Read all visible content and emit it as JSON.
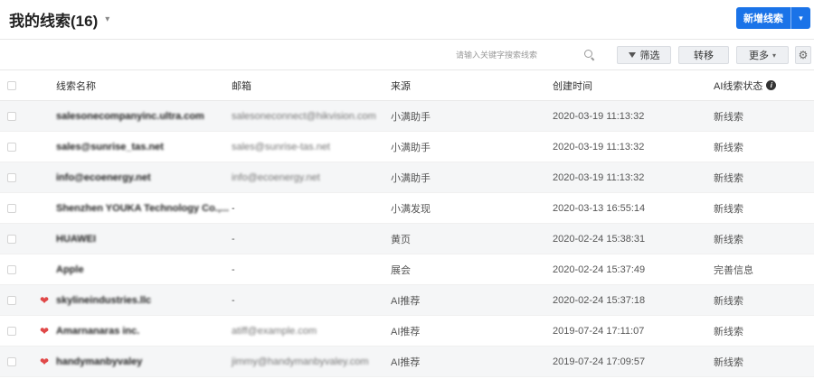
{
  "header": {
    "title": "我的线索(16)",
    "title_caret": "▾",
    "new_button_label": "新增线索",
    "new_button_caret": "▾"
  },
  "toolbar": {
    "search_placeholder": "请输入关键字搜索线索",
    "filter_label": "筛选",
    "move_label": "转移",
    "more_label": "更多",
    "more_caret": "▾",
    "gear_glyph": "⚙"
  },
  "table": {
    "columns": {
      "name": "线索名称",
      "email": "邮箱",
      "source": "来源",
      "created": "创建时间",
      "status": "AI线索状态",
      "status_info": "i"
    },
    "rows": [
      {
        "starred": false,
        "name": "salesonecompanyinc.ultra.com",
        "email": "salesoneconnect@hikvision.com",
        "source": "小满助手",
        "created": "2020-03-19 11:13:32",
        "status": "新线索"
      },
      {
        "starred": false,
        "name": "sales@sunrise_tas.net",
        "email": "sales@sunrise-tas.net",
        "source": "小满助手",
        "created": "2020-03-19 11:13:32",
        "status": "新线索"
      },
      {
        "starred": false,
        "name": "info@ecoenergy.net",
        "email": "info@ecoenergy.net",
        "source": "小满助手",
        "created": "2020-03-19 11:13:32",
        "status": "新线索"
      },
      {
        "starred": false,
        "name": "Shenzhen YOUKA Technology Co.,...",
        "email": "-",
        "source": "小满发现",
        "created": "2020-03-13 16:55:14",
        "status": "新线索"
      },
      {
        "starred": false,
        "name": "HUAWEI",
        "email": "-",
        "source": "黄页",
        "created": "2020-02-24 15:38:31",
        "status": "新线索"
      },
      {
        "starred": false,
        "name": "Apple",
        "email": "-",
        "source": "展会",
        "created": "2020-02-24 15:37:49",
        "status": "完善信息"
      },
      {
        "starred": true,
        "name": "skylineindustries.llc",
        "email": "-",
        "source": "AI推荐",
        "created": "2020-02-24 15:37:18",
        "status": "新线索"
      },
      {
        "starred": true,
        "name": "Amarnanaras inc.",
        "email": "atiff@example.com",
        "source": "AI推荐",
        "created": "2019-07-24 17:11:07",
        "status": "新线索"
      },
      {
        "starred": true,
        "name": "handymanbyvaley",
        "email": "jimmy@handymanbyvaley.com",
        "source": "AI推荐",
        "created": "2019-07-24 17:09:57",
        "status": "新线索"
      }
    ]
  },
  "icons": {
    "heart": "heart-icon",
    "search": "search-icon",
    "filter": "funnel-icon",
    "settings": "gear-icon"
  },
  "colors": {
    "primary": "#1a73e8",
    "heart": "#e04848",
    "stripe": "#f5f6f7"
  }
}
